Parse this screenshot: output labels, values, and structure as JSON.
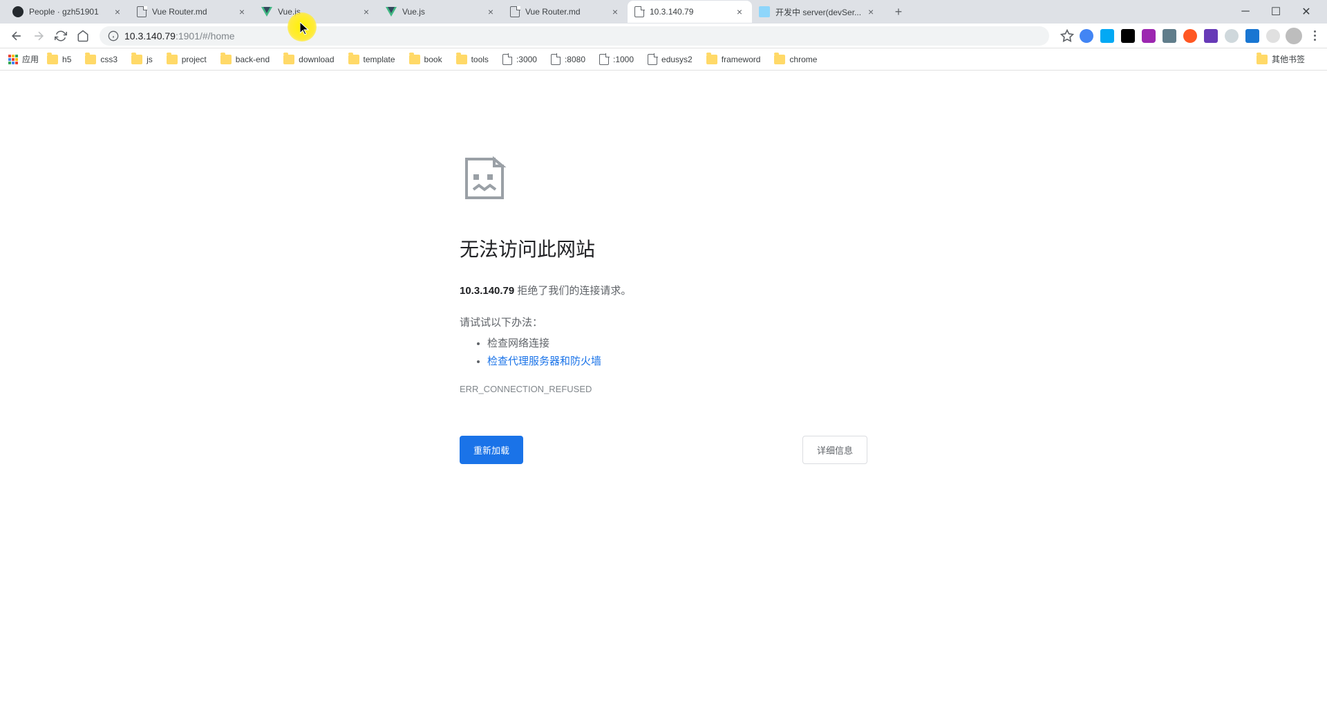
{
  "tabs": [
    {
      "title": "People · gzh51901",
      "icon": "github"
    },
    {
      "title": "Vue Router.md",
      "icon": "file"
    },
    {
      "title": "Vue.js",
      "icon": "vue"
    },
    {
      "title": "Vue.js",
      "icon": "vue"
    },
    {
      "title": "Vue Router.md",
      "icon": "file"
    },
    {
      "title": "10.3.140.79",
      "icon": "file",
      "active": true
    },
    {
      "title": "开发中 server(devSer...",
      "icon": "webpack"
    }
  ],
  "url": {
    "host": "10.3.140.79",
    "path": ":1901/#/home"
  },
  "apps_label": "应用",
  "bookmarks": [
    {
      "label": "h5",
      "type": "folder"
    },
    {
      "label": "css3",
      "type": "folder"
    },
    {
      "label": "js",
      "type": "folder"
    },
    {
      "label": "project",
      "type": "folder"
    },
    {
      "label": "back-end",
      "type": "folder"
    },
    {
      "label": "download",
      "type": "folder"
    },
    {
      "label": "template",
      "type": "folder"
    },
    {
      "label": "book",
      "type": "folder"
    },
    {
      "label": "tools",
      "type": "folder"
    },
    {
      "label": ":3000",
      "type": "file"
    },
    {
      "label": ":8080",
      "type": "file"
    },
    {
      "label": ":1000",
      "type": "file"
    },
    {
      "label": "edusys2",
      "type": "file"
    },
    {
      "label": "frameword",
      "type": "folder"
    },
    {
      "label": "chrome",
      "type": "folder"
    }
  ],
  "other_bookmarks": "其他书签",
  "error": {
    "title": "无法访问此网站",
    "host": "10.3.140.79",
    "desc_suffix": " 拒绝了我们的连接请求。",
    "try_label": "请试试以下办法：",
    "suggestion1": "检查网络连接",
    "suggestion2": "检查代理服务器和防火墙",
    "code": "ERR_CONNECTION_REFUSED",
    "reload_btn": "重新加载",
    "details_btn": "详细信息"
  }
}
